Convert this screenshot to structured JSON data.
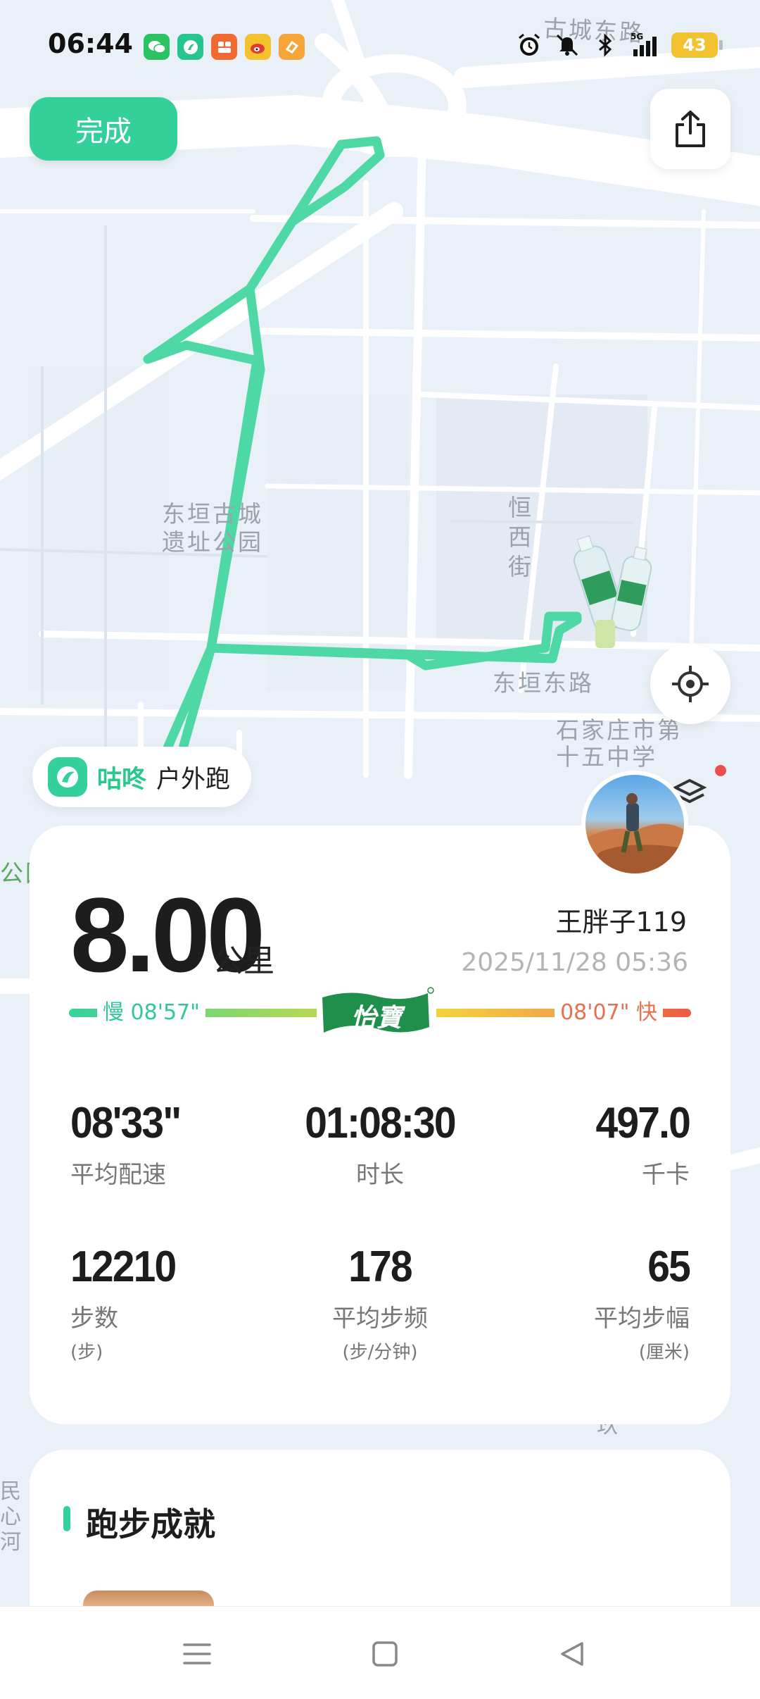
{
  "status_bar": {
    "time": "06:44",
    "battery": "43",
    "notification_icons": [
      "wechat-icon",
      "app-icon",
      "video-app-icon",
      "weibo-icon",
      "app-icon"
    ],
    "system_icons": [
      "alarm-icon",
      "mute-icon",
      "bluetooth-icon",
      "signal-5g-icon"
    ]
  },
  "top_controls": {
    "done_label": "完成",
    "share_icon": "share-icon",
    "locate_icon": "locate-icon"
  },
  "map": {
    "labels": {
      "road_top": "古城东路",
      "park": "东垣古城\n遗址公园",
      "street": "恒\n西\n街",
      "road_bottom": "东垣东路",
      "school": "石家庄市第\n十五中学",
      "edge_left": "公园",
      "edge_bottom_left": "民\n心\n河",
      "edge_bottom_right": "玖"
    },
    "route_color": "#4dd8a6",
    "road_color": "#ffffff",
    "background_color": "#eaf0f7"
  },
  "brand": {
    "name": "咕咚",
    "sport": "户外跑",
    "accent_color": "#29c98d"
  },
  "summary": {
    "distance": "8.00",
    "distance_unit": "公里",
    "username": "王胖子119",
    "date": "2025/11/28 05:36",
    "pace_slow_label": "慢 08'57\"",
    "pace_fast_label": "08'07\" 快",
    "sponsor_text": "怡寶",
    "stats": [
      {
        "value": "08'33\"",
        "label": "平均配速",
        "sub": ""
      },
      {
        "value": "01:08:30",
        "label": "时长",
        "sub": ""
      },
      {
        "value": "497.0",
        "label": "千卡",
        "sub": ""
      },
      {
        "value": "12210",
        "label": "步数",
        "sub": "(步)"
      },
      {
        "value": "178",
        "label": "平均步频",
        "sub": "(步/分钟)"
      },
      {
        "value": "65",
        "label": "平均步幅",
        "sub": "(厘米)"
      }
    ]
  },
  "achievements": {
    "title": "跑步成就"
  },
  "nav": {
    "icons": [
      "menu-icon",
      "home-icon",
      "back-icon"
    ]
  }
}
